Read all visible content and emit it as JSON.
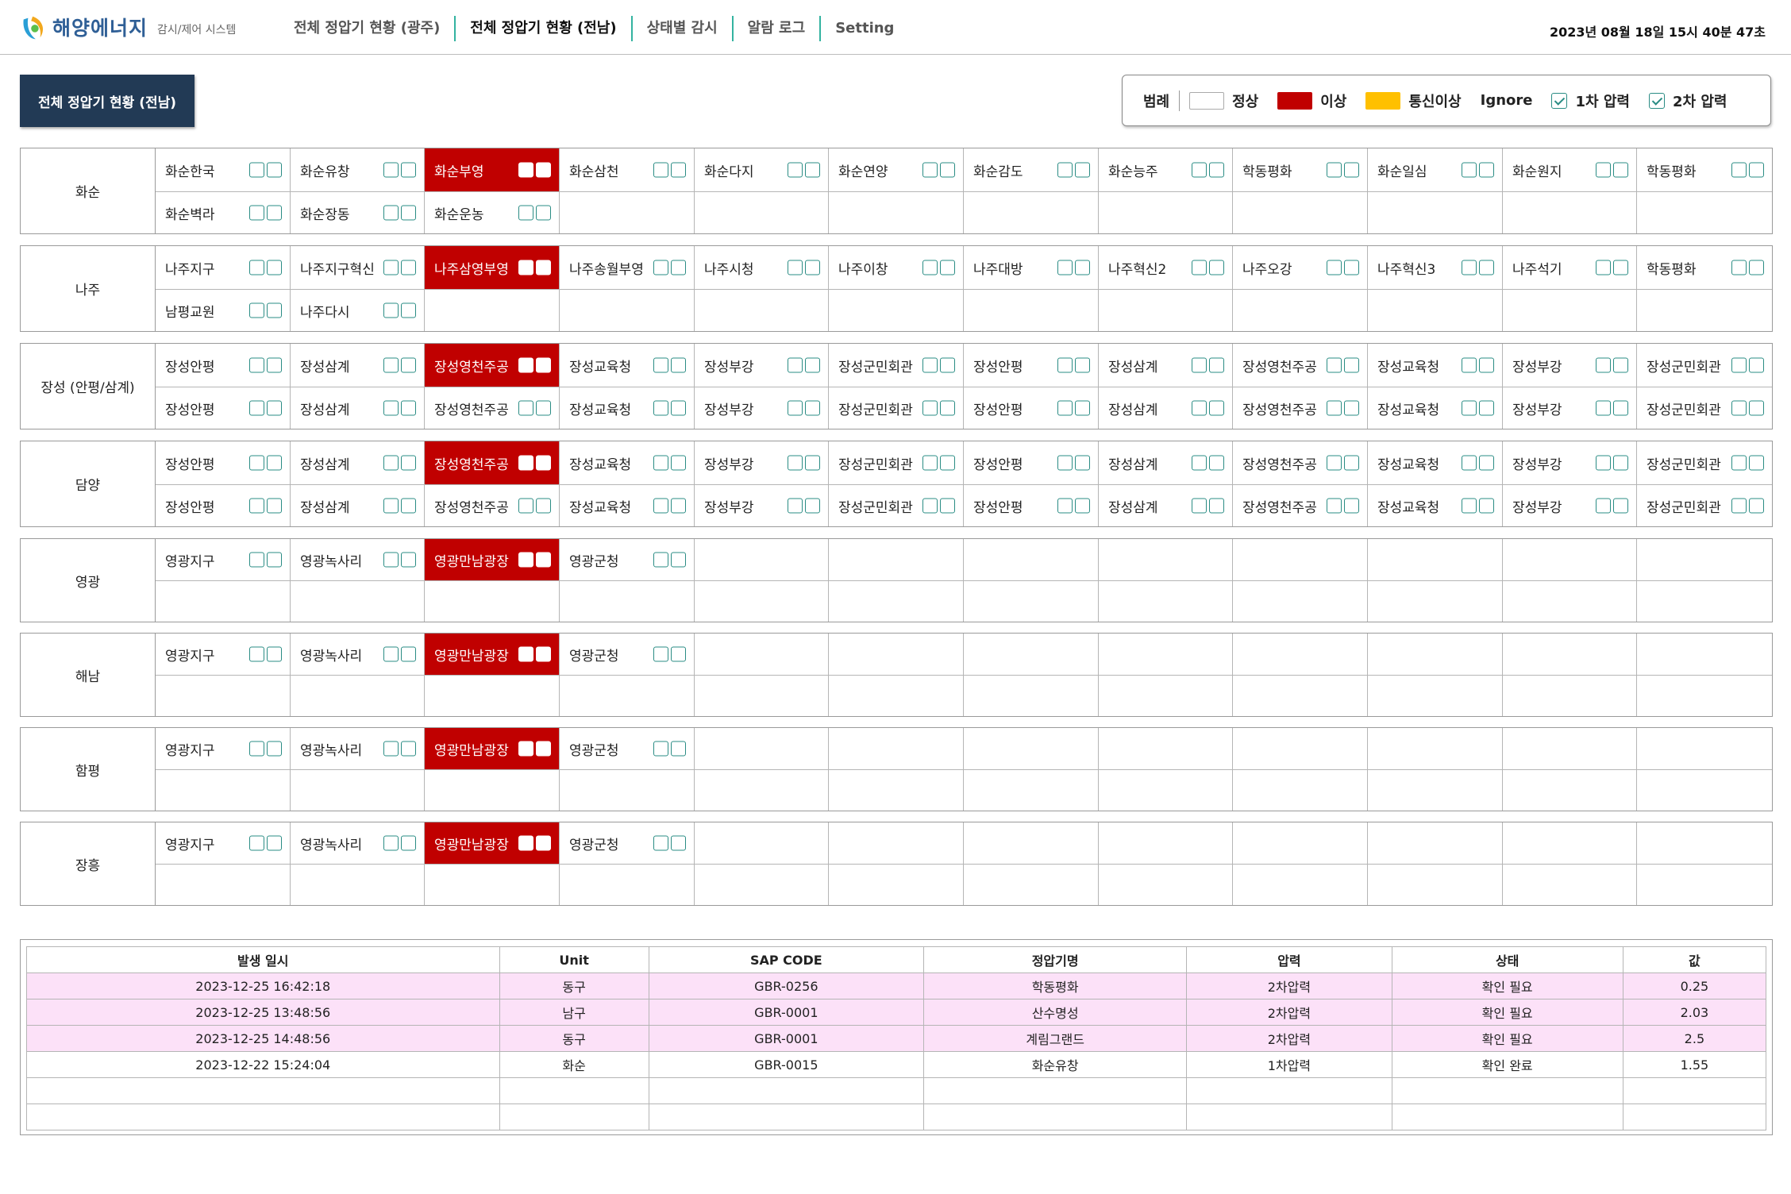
{
  "app": {
    "logo_text": "해양에너지",
    "logo_subtitle": "감시/제어 시스템",
    "clock": "2023년 08월 18일 15시 40분 47초",
    "nav": [
      {
        "label": "전체 정압기 현황 (광주)"
      },
      {
        "label": "전체 정압기 현황 (전남)"
      },
      {
        "label": "상태별 감시"
      },
      {
        "label": "알람 로그"
      },
      {
        "label": "Setting"
      }
    ],
    "active_nav": 1
  },
  "page_title": "전체 정압기 현황 (전남)",
  "legend": {
    "title": "범례",
    "items": [
      {
        "label": "정상",
        "color": "#ffffff"
      },
      {
        "label": "이상",
        "color": "#c00000"
      },
      {
        "label": "통신이상",
        "color": "#ffc000"
      },
      {
        "label": "Ignore",
        "color": ""
      }
    ],
    "checks": [
      {
        "label": "1차 압력",
        "checked": true
      },
      {
        "label": "2차 압력",
        "checked": true
      }
    ]
  },
  "status_colors": {
    "normal": "#ffffff",
    "abnormal": "#c00000",
    "comm_error": "#ffc000"
  },
  "regions": [
    {
      "name": "화순",
      "rows": [
        [
          {
            "n": "화순한국",
            "s": "normal"
          },
          {
            "n": "화순유창",
            "s": "normal"
          },
          {
            "n": "화순부영",
            "s": "abnormal"
          },
          {
            "n": "화순삼천",
            "s": "normal"
          },
          {
            "n": "화순다지",
            "s": "normal"
          },
          {
            "n": "화순연양",
            "s": "normal"
          },
          {
            "n": "화순감도",
            "s": "normal"
          },
          {
            "n": "화순능주",
            "s": "normal"
          },
          {
            "n": "학동평화",
            "s": "normal"
          },
          {
            "n": "화순일심",
            "s": "normal"
          },
          {
            "n": "화순원지",
            "s": "normal"
          },
          {
            "n": "학동평화",
            "s": "normal"
          }
        ],
        [
          {
            "n": "화순벽라",
            "s": "normal"
          },
          {
            "n": "화순장동",
            "s": "normal"
          },
          {
            "n": "화순운농",
            "s": "normal"
          }
        ]
      ]
    },
    {
      "name": "나주",
      "rows": [
        [
          {
            "n": "나주지구",
            "s": "normal"
          },
          {
            "n": "나주지구혁신",
            "s": "normal"
          },
          {
            "n": "나주삼영부영",
            "s": "abnormal"
          },
          {
            "n": "나주송월부영",
            "s": "normal"
          },
          {
            "n": "나주시청",
            "s": "normal"
          },
          {
            "n": "나주이창",
            "s": "normal"
          },
          {
            "n": "나주대방",
            "s": "normal"
          },
          {
            "n": "나주혁신2",
            "s": "normal"
          },
          {
            "n": "나주오강",
            "s": "normal"
          },
          {
            "n": "나주혁신3",
            "s": "normal"
          },
          {
            "n": "나주석기",
            "s": "normal"
          },
          {
            "n": "학동평화",
            "s": "normal"
          }
        ],
        [
          {
            "n": "남평교원",
            "s": "normal"
          },
          {
            "n": "나주다시",
            "s": "normal"
          }
        ]
      ]
    },
    {
      "name": "장성 (안평/삼계)",
      "rows": [
        [
          {
            "n": "장성안평",
            "s": "normal"
          },
          {
            "n": "장성삼계",
            "s": "normal"
          },
          {
            "n": "장성영천주공",
            "s": "abnormal"
          },
          {
            "n": "장성교육청",
            "s": "normal"
          },
          {
            "n": "장성부강",
            "s": "normal"
          },
          {
            "n": "장성군민회관",
            "s": "normal"
          },
          {
            "n": "장성안평",
            "s": "normal"
          },
          {
            "n": "장성삼계",
            "s": "normal"
          },
          {
            "n": "장성영천주공",
            "s": "normal"
          },
          {
            "n": "장성교육청",
            "s": "normal"
          },
          {
            "n": "장성부강",
            "s": "normal"
          },
          {
            "n": "장성군민회관",
            "s": "normal"
          }
        ],
        [
          {
            "n": "장성안평",
            "s": "normal"
          },
          {
            "n": "장성삼계",
            "s": "normal"
          },
          {
            "n": "장성영천주공",
            "s": "normal"
          },
          {
            "n": "장성교육청",
            "s": "normal"
          },
          {
            "n": "장성부강",
            "s": "normal"
          },
          {
            "n": "장성군민회관",
            "s": "normal"
          },
          {
            "n": "장성안평",
            "s": "normal"
          },
          {
            "n": "장성삼계",
            "s": "normal"
          },
          {
            "n": "장성영천주공",
            "s": "normal"
          },
          {
            "n": "장성교육청",
            "s": "normal"
          },
          {
            "n": "장성부강",
            "s": "normal"
          },
          {
            "n": "장성군민회관",
            "s": "normal"
          }
        ]
      ]
    },
    {
      "name": "담양",
      "rows": [
        [
          {
            "n": "장성안평",
            "s": "normal"
          },
          {
            "n": "장성삼계",
            "s": "normal"
          },
          {
            "n": "장성영천주공",
            "s": "abnormal"
          },
          {
            "n": "장성교육청",
            "s": "normal"
          },
          {
            "n": "장성부강",
            "s": "normal"
          },
          {
            "n": "장성군민회관",
            "s": "normal"
          },
          {
            "n": "장성안평",
            "s": "normal"
          },
          {
            "n": "장성삼계",
            "s": "normal"
          },
          {
            "n": "장성영천주공",
            "s": "normal"
          },
          {
            "n": "장성교육청",
            "s": "normal"
          },
          {
            "n": "장성부강",
            "s": "normal"
          },
          {
            "n": "장성군민회관",
            "s": "normal"
          }
        ],
        [
          {
            "n": "장성안평",
            "s": "normal"
          },
          {
            "n": "장성삼계",
            "s": "normal"
          },
          {
            "n": "장성영천주공",
            "s": "normal"
          },
          {
            "n": "장성교육청",
            "s": "normal"
          },
          {
            "n": "장성부강",
            "s": "normal"
          },
          {
            "n": "장성군민회관",
            "s": "normal"
          },
          {
            "n": "장성안평",
            "s": "normal"
          },
          {
            "n": "장성삼계",
            "s": "normal"
          },
          {
            "n": "장성영천주공",
            "s": "normal"
          },
          {
            "n": "장성교육청",
            "s": "normal"
          },
          {
            "n": "장성부강",
            "s": "normal"
          },
          {
            "n": "장성군민회관",
            "s": "normal"
          }
        ]
      ]
    },
    {
      "name": "영광",
      "rows": [
        [
          {
            "n": "영광지구",
            "s": "normal"
          },
          {
            "n": "영광녹사리",
            "s": "normal"
          },
          {
            "n": "영광만남광장",
            "s": "abnormal"
          },
          {
            "n": "영광군청",
            "s": "normal"
          }
        ],
        []
      ]
    },
    {
      "name": "해남",
      "rows": [
        [
          {
            "n": "영광지구",
            "s": "normal"
          },
          {
            "n": "영광녹사리",
            "s": "normal"
          },
          {
            "n": "영광만남광장",
            "s": "abnormal"
          },
          {
            "n": "영광군청",
            "s": "normal"
          }
        ],
        []
      ]
    },
    {
      "name": "함평",
      "rows": [
        [
          {
            "n": "영광지구",
            "s": "normal"
          },
          {
            "n": "영광녹사리",
            "s": "normal"
          },
          {
            "n": "영광만남광장",
            "s": "abnormal"
          },
          {
            "n": "영광군청",
            "s": "normal"
          }
        ],
        []
      ]
    },
    {
      "name": "장흥",
      "rows": [
        [
          {
            "n": "영광지구",
            "s": "normal"
          },
          {
            "n": "영광녹사리",
            "s": "normal"
          },
          {
            "n": "영광만남광장",
            "s": "abnormal"
          },
          {
            "n": "영광군청",
            "s": "normal"
          }
        ],
        []
      ]
    }
  ],
  "alarm_table": {
    "headers": [
      "발생 일시",
      "Unit",
      "SAP CODE",
      "정압기명",
      "압력",
      "상태",
      "값"
    ],
    "rows": [
      {
        "cells": [
          "2023-12-25 16:42:18",
          "동구",
          "GBR-0256",
          "학동평화",
          "2차압력",
          "확인 필요",
          "0.25"
        ],
        "highlight": true
      },
      {
        "cells": [
          "2023-12-25 13:48:56",
          "남구",
          "GBR-0001",
          "산수명성",
          "2차압력",
          "확인 필요",
          "2.03"
        ],
        "highlight": true
      },
      {
        "cells": [
          "2023-12-25 14:48:56",
          "동구",
          "GBR-0001",
          "계림그랜드",
          "2차압력",
          "확인 필요",
          "2.5"
        ],
        "highlight": true
      },
      {
        "cells": [
          "2023-12-22 15:24:04",
          "화순",
          "GBR-0015",
          "화순유창",
          "1차압력",
          "확인 완료",
          "1.55"
        ],
        "highlight": false
      },
      {
        "cells": [
          "",
          "",
          "",
          "",
          "",
          "",
          ""
        ],
        "highlight": false
      },
      {
        "cells": [
          "",
          "",
          "",
          "",
          "",
          "",
          ""
        ],
        "highlight": false
      }
    ]
  }
}
